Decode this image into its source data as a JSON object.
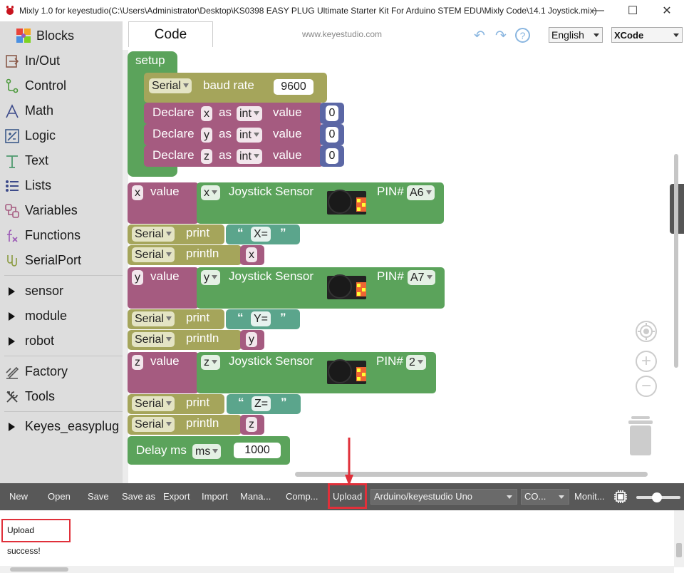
{
  "window": {
    "title": "Mixly 1.0 for keyestudio(C:\\Users\\Administrator\\Desktop\\KS0398 EASY PLUG Ultimate Starter Kit For Arduino STEM EDU\\Mixly Code\\14.1 Joystick.mix)",
    "controls": {
      "minimize": "—",
      "maximize": "☐",
      "close": "✕"
    }
  },
  "sidebar": {
    "header": "Blocks",
    "items": [
      {
        "label": "In/Out",
        "icon": "in-out-icon"
      },
      {
        "label": "Control",
        "icon": "control-icon"
      },
      {
        "label": "Math",
        "icon": "math-icon"
      },
      {
        "label": "Logic",
        "icon": "logic-icon"
      },
      {
        "label": "Text",
        "icon": "text-icon"
      },
      {
        "label": "Lists",
        "icon": "lists-icon"
      },
      {
        "label": "Variables",
        "icon": "variables-icon"
      },
      {
        "label": "Functions",
        "icon": "functions-icon"
      },
      {
        "label": "SerialPort",
        "icon": "serialport-icon"
      }
    ],
    "groups": [
      {
        "label": "sensor"
      },
      {
        "label": "module"
      },
      {
        "label": "robot"
      }
    ],
    "tools": [
      {
        "label": "Factory",
        "icon": "factory-icon"
      },
      {
        "label": "Tools",
        "icon": "tools-icon"
      }
    ],
    "extra": [
      {
        "label": "Keyes_easyplug"
      }
    ]
  },
  "header": {
    "tab": "Code",
    "site": "www.keyestudio.com",
    "language": "English",
    "theme": "XCode"
  },
  "workspace": {
    "setup": {
      "title": "setup",
      "serial": "Serial",
      "baud_label": "baud rate",
      "baud": "9600",
      "declares": [
        {
          "kw": "Declare",
          "var": "x",
          "as": "as",
          "type": "int",
          "value_kw": "value",
          "value": "0"
        },
        {
          "kw": "Declare",
          "var": "y",
          "as": "as",
          "type": "int",
          "value_kw": "value",
          "value": "0"
        },
        {
          "kw": "Declare",
          "var": "z",
          "as": "as",
          "type": "int",
          "value_kw": "value",
          "value": "0"
        }
      ]
    },
    "groups": [
      {
        "var": "x",
        "value_kw": "value",
        "axis": "x",
        "sensor": "Joystick Sensor",
        "pin_label": "PIN#",
        "pin": "A6",
        "serial": "Serial",
        "print": "print",
        "text": "X=",
        "println": "println",
        "println_var": "x"
      },
      {
        "var": "y",
        "value_kw": "value",
        "axis": "y",
        "sensor": "Joystick Sensor",
        "pin_label": "PIN#",
        "pin": "A7",
        "serial": "Serial",
        "print": "print",
        "text": "Y=",
        "println": "println",
        "println_var": "y"
      },
      {
        "var": "z",
        "value_kw": "value",
        "axis": "z",
        "sensor": "Joystick Sensor",
        "pin_label": "PIN#",
        "pin": "2",
        "serial": "Serial",
        "print": "print",
        "text": "Z=",
        "println": "println",
        "println_var": "z"
      }
    ],
    "delay": {
      "label": "Delay ms",
      "unit": "ms",
      "value": "1000"
    },
    "quote_open": "“",
    "quote_close": "”"
  },
  "toolbar": {
    "buttons": [
      "New",
      "Open",
      "Save",
      "Save as",
      "Export",
      "Import",
      "Mana...",
      "Comp...",
      "Upload"
    ],
    "board": "Arduino/keyestudio Uno",
    "port": "CO...",
    "monitor": "Monit..."
  },
  "console": {
    "message": "Upload success!"
  },
  "colors": {
    "setup_green": "#5ba35b",
    "serial_olive": "#a5a55b",
    "variable_purple": "#a55b80",
    "math_blue": "#5b67a5",
    "text_teal": "#5ba58c",
    "highlight_red": "#e0303a",
    "toolbar_gray": "#585858",
    "sidebar_gray": "#dddddd"
  }
}
